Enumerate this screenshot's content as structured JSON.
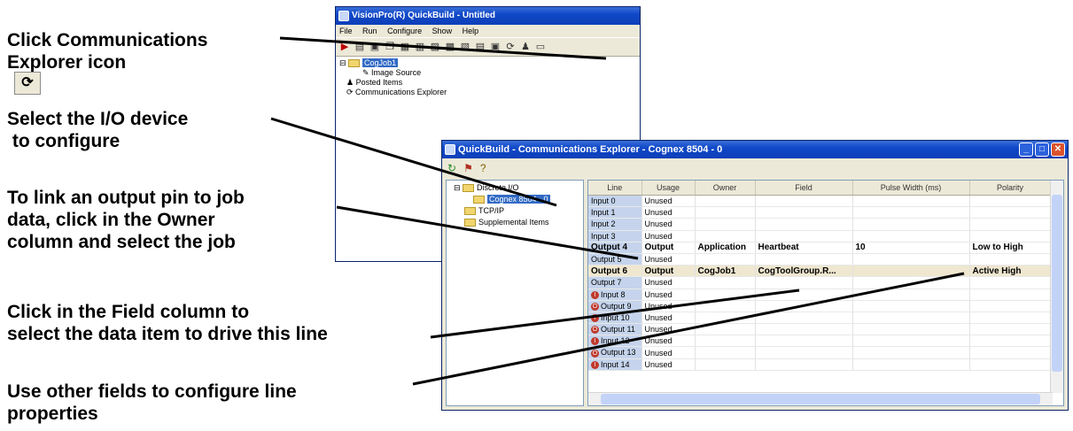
{
  "callouts": [
    {
      "lines": [
        "Click Communications",
        "Explorer icon"
      ]
    },
    {
      "lines": [
        "Select the I/O device",
        " to configure"
      ]
    },
    {
      "lines": [
        "To link an output pin to job",
        "data, click in the Owner",
        "column and select the job"
      ]
    },
    {
      "lines": [
        "Click in the Field column to",
        "select the data item to drive this line"
      ]
    },
    {
      "lines": [
        "Use other fields to configure line",
        "properties"
      ]
    }
  ],
  "quickbuild": {
    "title": "VisionPro(R) QuickBuild - Untitled",
    "menu": [
      "File",
      "Run",
      "Configure",
      "Show",
      "Help"
    ],
    "tree": [
      "CogJob1",
      "Image Source",
      "Posted Items",
      "Communications Explorer"
    ]
  },
  "explorer": {
    "title": "QuickBuild - Communications Explorer - Cognex 8504 - 0",
    "tree": [
      "Discrete I/O",
      "Cognex 8504 - 0",
      "TCP/IP",
      "Supplemental Items"
    ],
    "columns": [
      "Line",
      "Usage",
      "Owner",
      "Field",
      "Pulse Width (ms)",
      "Polarity"
    ],
    "rows": [
      {
        "line": "Input 0",
        "usage": "Unused",
        "owner": "",
        "field": "",
        "pulse": "",
        "polarity": "",
        "badge": ""
      },
      {
        "line": "Input 1",
        "usage": "Unused",
        "owner": "",
        "field": "",
        "pulse": "",
        "polarity": "",
        "badge": ""
      },
      {
        "line": "Input 2",
        "usage": "Unused",
        "owner": "",
        "field": "",
        "pulse": "",
        "polarity": "",
        "badge": ""
      },
      {
        "line": "Input 3",
        "usage": "Unused",
        "owner": "",
        "field": "",
        "pulse": "",
        "polarity": "",
        "badge": ""
      },
      {
        "line": "Output 4",
        "usage": "Output",
        "owner": "Application",
        "field": "Heartbeat",
        "pulse": "10",
        "polarity": "Low to High",
        "badge": "",
        "bold": true
      },
      {
        "line": "Output 5",
        "usage": "Unused",
        "owner": "",
        "field": "",
        "pulse": "",
        "polarity": "",
        "badge": ""
      },
      {
        "line": "Output 6",
        "usage": "Output",
        "owner": "CogJob1",
        "field": "CogToolGroup.R...",
        "pulse": "",
        "polarity": "Active High",
        "badge": "",
        "bold": true,
        "highlight": true
      },
      {
        "line": "Output 7",
        "usage": "Unused",
        "owner": "",
        "field": "",
        "pulse": "",
        "polarity": "",
        "badge": ""
      },
      {
        "line": "Input 8",
        "usage": "Unused",
        "owner": "",
        "field": "",
        "pulse": "",
        "polarity": "",
        "badge": "I"
      },
      {
        "line": "Output 9",
        "usage": "Unused",
        "owner": "",
        "field": "",
        "pulse": "",
        "polarity": "",
        "badge": "O"
      },
      {
        "line": "Input 10",
        "usage": "Unused",
        "owner": "",
        "field": "",
        "pulse": "",
        "polarity": "",
        "badge": "I"
      },
      {
        "line": "Output 11",
        "usage": "Unused",
        "owner": "",
        "field": "",
        "pulse": "",
        "polarity": "",
        "badge": "O"
      },
      {
        "line": "Input 12",
        "usage": "Unused",
        "owner": "",
        "field": "",
        "pulse": "",
        "polarity": "",
        "badge": "I"
      },
      {
        "line": "Output 13",
        "usage": "Unused",
        "owner": "",
        "field": "",
        "pulse": "",
        "polarity": "",
        "badge": "O"
      },
      {
        "line": "Input 14",
        "usage": "Unused",
        "owner": "",
        "field": "",
        "pulse": "",
        "polarity": "",
        "badge": "I"
      }
    ]
  },
  "colors": {
    "titlebar": "#0d3fb8",
    "selection": "#316ac5",
    "line_column": "#c5d4ec"
  }
}
